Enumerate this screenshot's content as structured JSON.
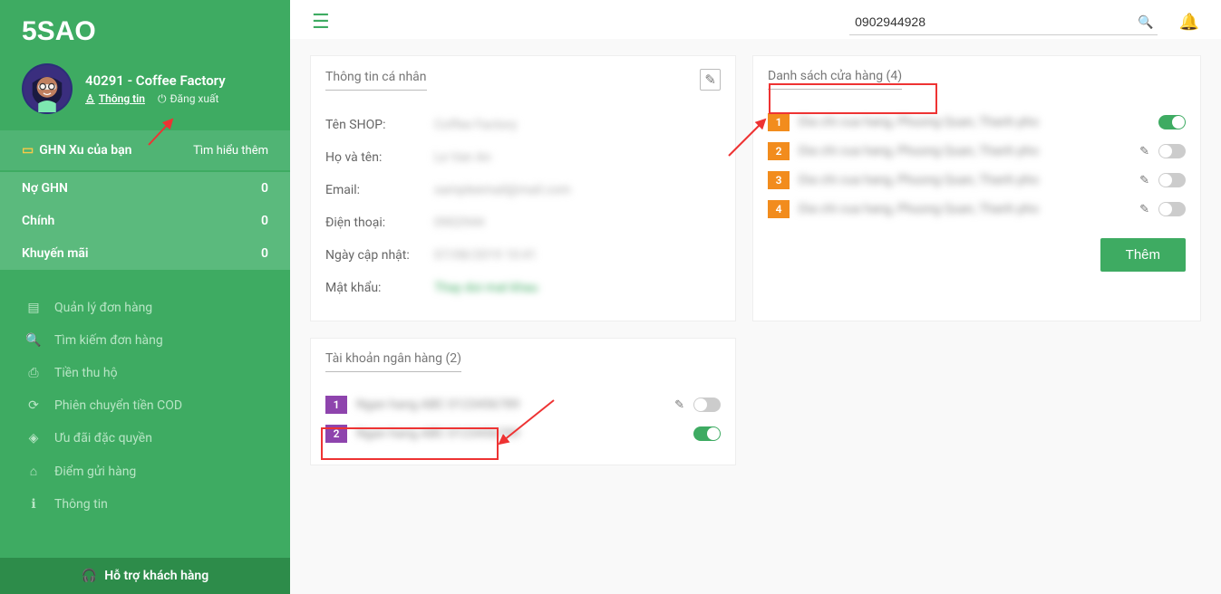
{
  "logo": "5SAO",
  "profile": {
    "title": "40291 - Coffee Factory",
    "link_info": "Thông tin",
    "link_logout": "Đăng xuất"
  },
  "balance": {
    "title": "GHN Xu của bạn",
    "learn_more": "Tìm hiểu thêm",
    "rows": [
      {
        "label": "Nợ GHN",
        "value": "0"
      },
      {
        "label": "Chính",
        "value": "0"
      },
      {
        "label": "Khuyến mãi",
        "value": "0"
      }
    ]
  },
  "nav": {
    "items": [
      {
        "icon": "list-icon",
        "label": "Quản lý đơn hàng"
      },
      {
        "icon": "search-icon",
        "label": "Tìm kiếm đơn hàng"
      },
      {
        "icon": "money-icon",
        "label": "Tiền thu hộ"
      },
      {
        "icon": "refresh-icon",
        "label": "Phiên chuyển tiền COD"
      },
      {
        "icon": "diamond-icon",
        "label": "Ưu đãi đặc quyền"
      },
      {
        "icon": "home-icon",
        "label": "Điểm gửi hàng"
      },
      {
        "icon": "info-icon",
        "label": "Thông tin"
      }
    ]
  },
  "footer": {
    "label": "Hỗ trợ khách hàng"
  },
  "search": {
    "value": "0902944928"
  },
  "cards": {
    "personal": {
      "title": "Thông tin cá nhân",
      "rows": {
        "shop_label": "Tên SHOP:",
        "name_label": "Họ và tên:",
        "email_label": "Email:",
        "phone_label": "Điện thoại:",
        "updated_label": "Ngày cập nhật:",
        "password_label": "Mật khẩu:"
      }
    },
    "stores": {
      "title": "Danh sách cửa hàng (4)",
      "items": [
        {
          "num": "1",
          "on": true,
          "editable": false
        },
        {
          "num": "2",
          "on": false,
          "editable": true
        },
        {
          "num": "3",
          "on": false,
          "editable": true
        },
        {
          "num": "4",
          "on": false,
          "editable": true
        }
      ],
      "add_label": "Thêm"
    },
    "banks": {
      "title": "Tài khoản ngân hàng (2)",
      "items": [
        {
          "num": "1",
          "on": false,
          "editable": true
        },
        {
          "num": "2",
          "on": true,
          "editable": false
        }
      ]
    }
  },
  "colors": {
    "primary": "#3eab62",
    "orange": "#f28c1d",
    "purple": "#8e44ad",
    "red": "#e33"
  }
}
